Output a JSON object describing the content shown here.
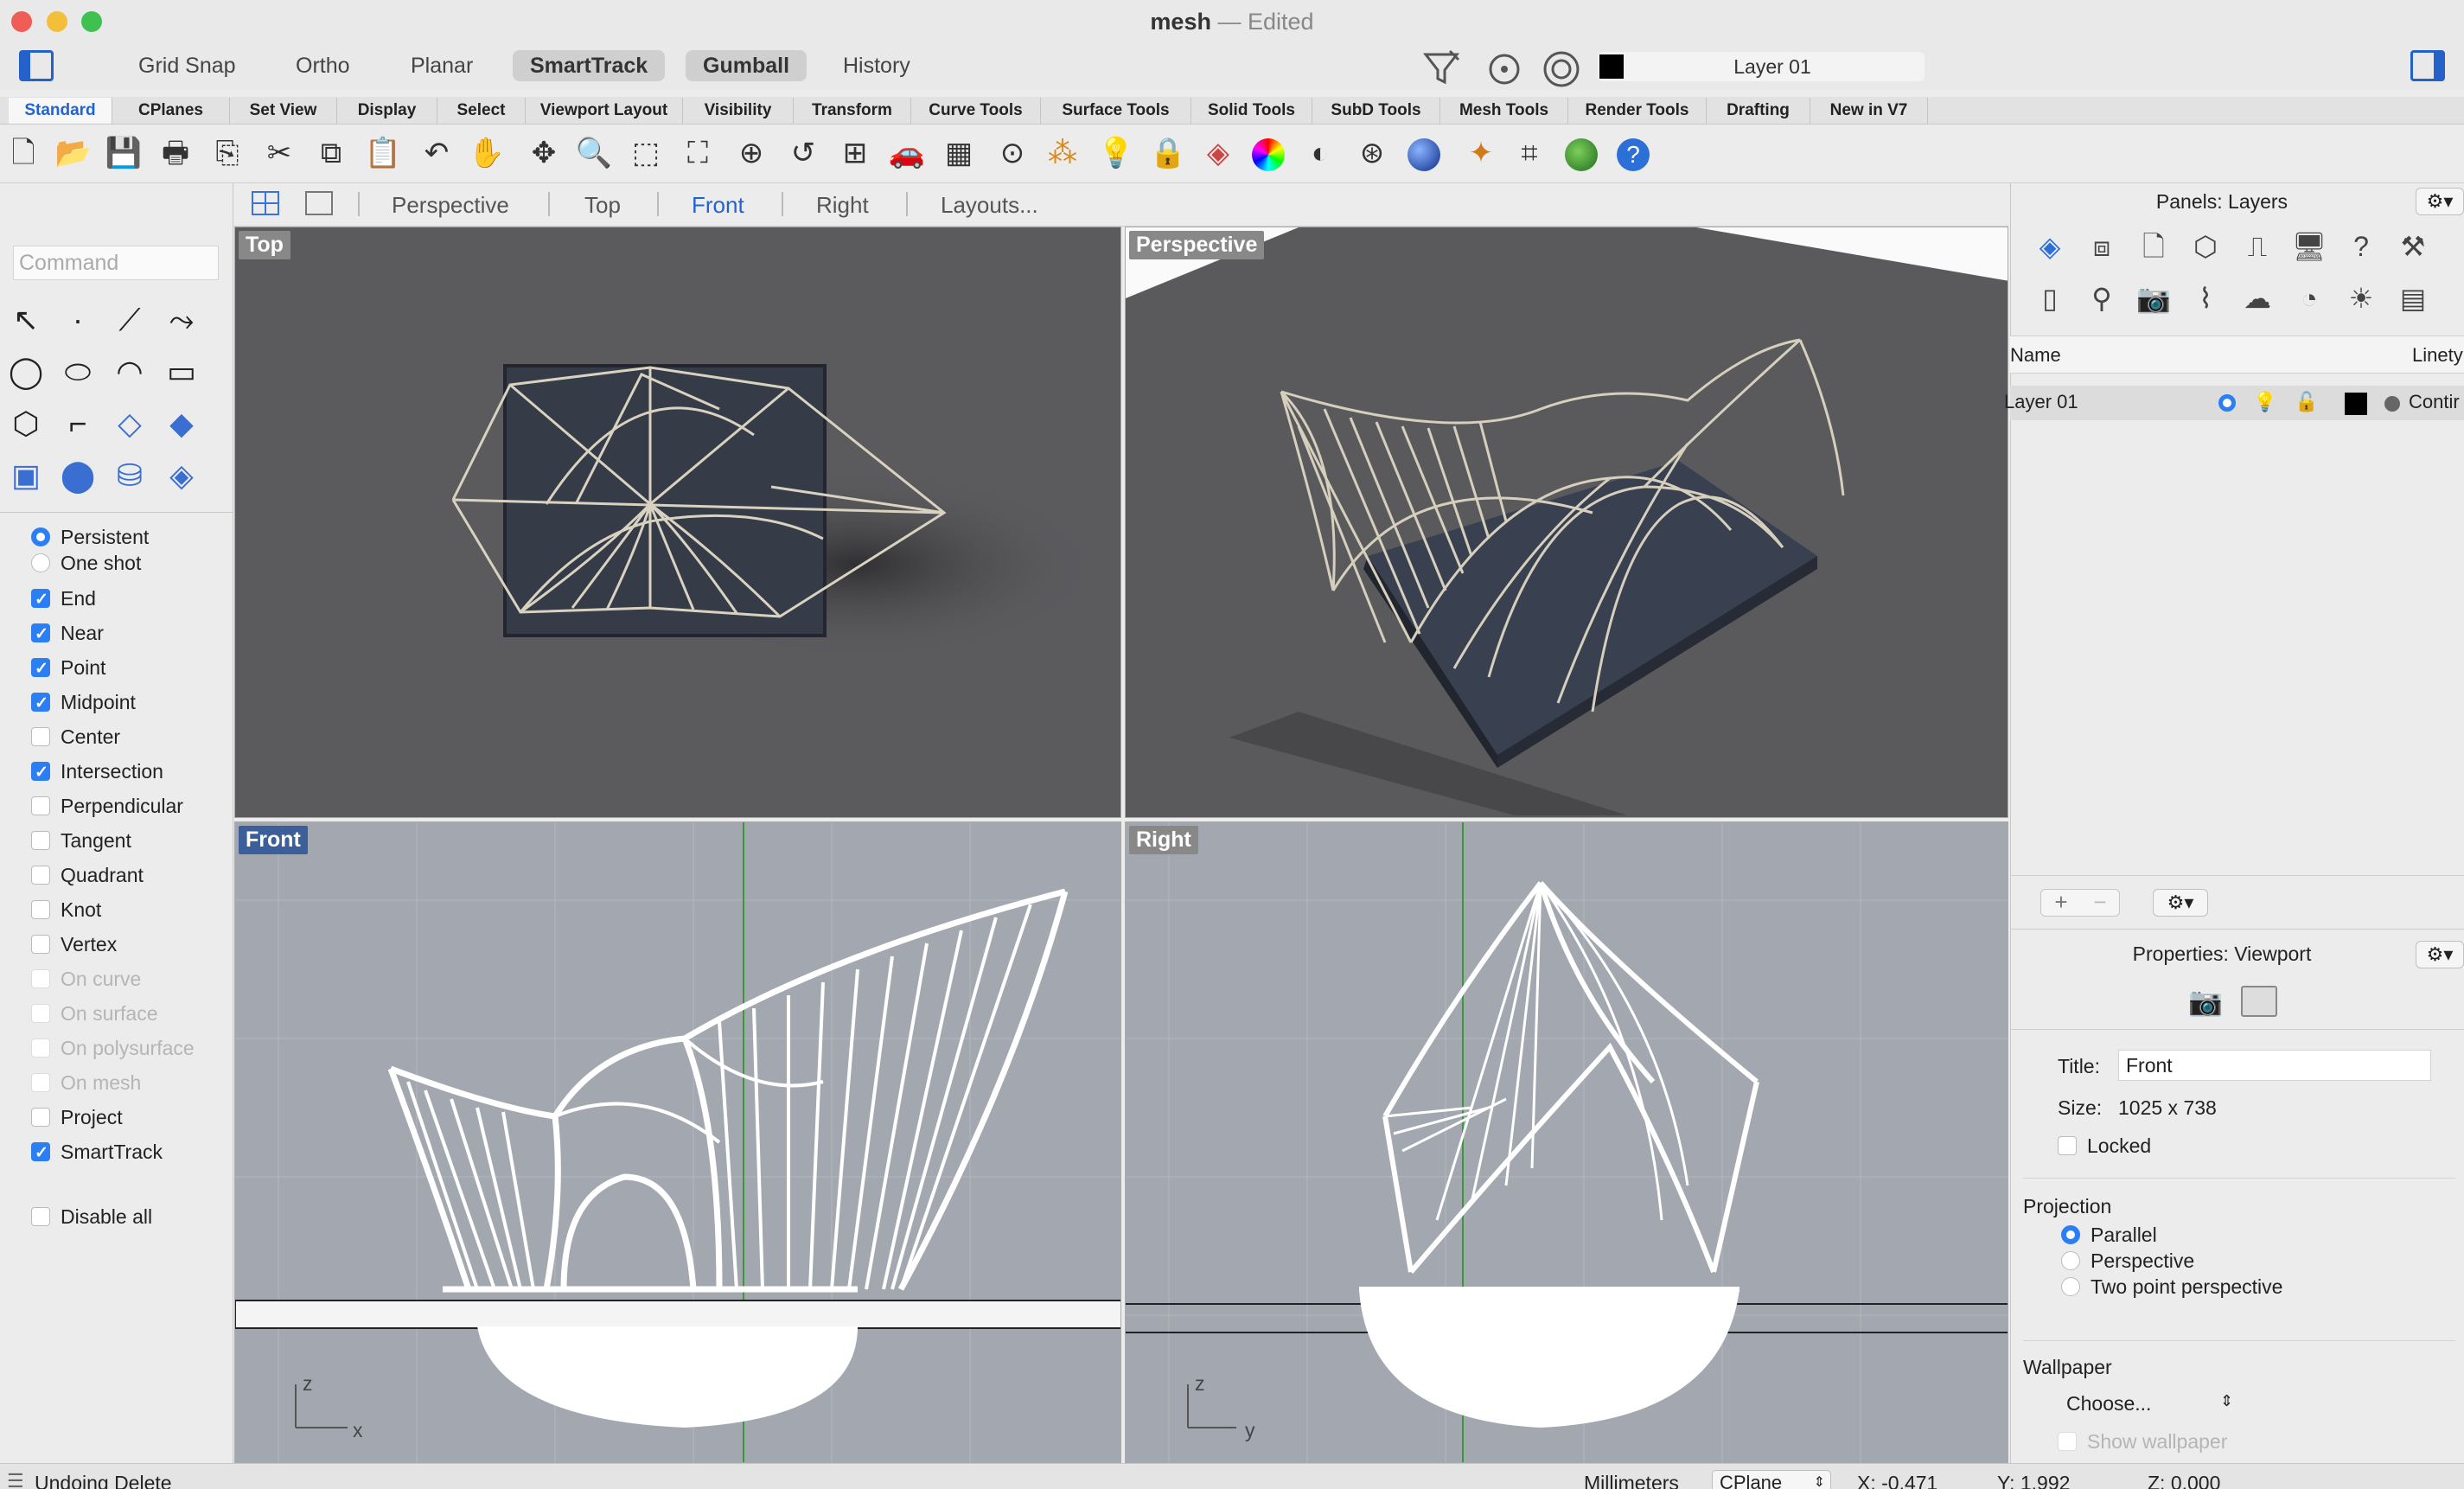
{
  "window": {
    "title": "mesh",
    "sep": "—",
    "status": "Edited"
  },
  "colors": {
    "accent": "#1f63d6",
    "checkbox": "#2c7ef5",
    "viewport_bg_dark": "#5b5b5e",
    "viewport_bg_light": "#a3a8b0"
  },
  "toolbar_toggles": [
    "Grid Snap",
    "Ortho",
    "Planar",
    "SmartTrack",
    "Gumball",
    "History"
  ],
  "current_layer": "Layer 01",
  "tabs": [
    "Standard",
    "CPlanes",
    "Set View",
    "Display",
    "Select",
    "Viewport Layout",
    "Visibility",
    "Transform",
    "Curve Tools",
    "Surface Tools",
    "Solid Tools",
    "SubD Tools",
    "Mesh Tools",
    "Render Tools",
    "Drafting",
    "New in V7"
  ],
  "command": {
    "placeholder": "Command"
  },
  "osnap_modes": {
    "persistent": "Persistent",
    "one_shot": "One shot"
  },
  "osnaps": [
    {
      "label": "End",
      "checked": true,
      "enabled": true
    },
    {
      "label": "Near",
      "checked": true,
      "enabled": true
    },
    {
      "label": "Point",
      "checked": true,
      "enabled": true
    },
    {
      "label": "Midpoint",
      "checked": true,
      "enabled": true
    },
    {
      "label": "Center",
      "checked": false,
      "enabled": true
    },
    {
      "label": "Intersection",
      "checked": true,
      "enabled": true
    },
    {
      "label": "Perpendicular",
      "checked": false,
      "enabled": true
    },
    {
      "label": "Tangent",
      "checked": false,
      "enabled": true
    },
    {
      "label": "Quadrant",
      "checked": false,
      "enabled": true
    },
    {
      "label": "Knot",
      "checked": false,
      "enabled": true
    },
    {
      "label": "Vertex",
      "checked": false,
      "enabled": true
    },
    {
      "label": "On curve",
      "checked": false,
      "enabled": false
    },
    {
      "label": "On surface",
      "checked": false,
      "enabled": false
    },
    {
      "label": "On polysurface",
      "checked": false,
      "enabled": false
    },
    {
      "label": "On mesh",
      "checked": false,
      "enabled": false
    },
    {
      "label": "Project",
      "checked": false,
      "enabled": true
    },
    {
      "label": "SmartTrack",
      "checked": true,
      "enabled": true
    }
  ],
  "disable_all": "Disable all",
  "viewport_tabs": [
    "Perspective",
    "Top",
    "Front",
    "Right",
    "Layouts..."
  ],
  "viewports": {
    "top": "Top",
    "perspective": "Perspective",
    "front": "Front",
    "right": "Right"
  },
  "axes": {
    "front_v": "z",
    "front_h": "x",
    "right_v": "z",
    "right_h": "y"
  },
  "layers_panel": {
    "title": "Panels: Layers",
    "col_name": "Name",
    "col_linetype": "Linety",
    "layer_name": "Layer 01",
    "linetype": "Contir"
  },
  "properties": {
    "title": "Properties: Viewport",
    "title_label": "Title:",
    "title_value": "Front",
    "size_label": "Size:",
    "size_value": "1025 x 738",
    "locked_label": "Locked",
    "projection_label": "Projection",
    "projections": [
      "Parallel",
      "Perspective",
      "Two point perspective"
    ],
    "wallpaper_label": "Wallpaper",
    "choose_label": "Choose...",
    "show_wallpaper": "Show wallpaper"
  },
  "status": {
    "message": "Undoing Delete",
    "units": "Millimeters",
    "cplane": "CPlane",
    "x": "X: -0.471",
    "y": "Y: 1.992",
    "z": "Z: 0.000"
  }
}
